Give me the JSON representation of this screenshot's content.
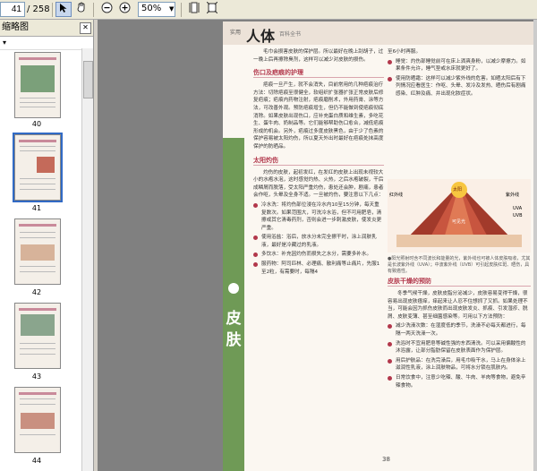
{
  "toolbar": {
    "page_current": "41",
    "page_total": "/ 258",
    "zoom": "50%",
    "icons": [
      "select-tool-icon",
      "hand-tool-icon",
      "zoom-out-icon",
      "zoom-in-icon",
      "fit-width-icon",
      "fit-page-icon"
    ]
  },
  "sidebar": {
    "title": "缩略图",
    "option_icon": "options-icon",
    "thumbs": [
      {
        "label": "40"
      },
      {
        "label": "41"
      },
      {
        "label": "42"
      },
      {
        "label": "43"
      },
      {
        "label": "44"
      }
    ]
  },
  "page": {
    "header_title": "人体",
    "header_sub": "实用",
    "header_tag": "百科全书",
    "side_label": "皮肤",
    "page_number": "38",
    "left": {
      "intro": "毛巾会损害皮肤的保护层。所以最好在晚上刮胡子，过一晚上后再擦除臭剂，这样可以减少对皮肤的损伤。",
      "h1": "伤口及疤痕的护理",
      "p1": "疤痕一旦产生，就不会消失，目前常用的几种疤痕治疗方法：切除疤痕至很健全，软组织扩张器扩张正常皮肤后修复疤痕；疤痕内药物注射，疤痕磨削术，外用药膏、涂等方法，可改善外观。预防疤痕增生，但仍不能做到使疤痕彻底消除。如果皮肤出现伤口，应补充蛋白质和维生素，多吃花生、蛋牛肉、奶制品等。它们能够帮助伤口愈合，减低疤痕形成的机会。另外，疤痕过多度皮肤黑色，由于少了色素的保护容易被太阳灼伤，所以夏天外出时最好在疤痕处抹高度保护的防晒品。",
      "h2": "太阳灼伤",
      "p2": "灼伤的皮肤，起初发红，在发红的皮肤上出现未视较大小的水疱水泡，这时感觉灼热、火热，之后水疱破裂，干后成鳞屑而脱落，受太阳严重灼伤，患处还会肿，剧痛，患者会作呕，头晕及全身不适。一旦被灼伤，要注意以下几点：",
      "b1": "冷水洗：将灼伤部位浸在冷水内10至15分钟，每天重复数次。如果范围大，可洗冷水浴，但不可用肥皂，清擦或其它清毒药剂，否则会进一步刺激皮肤，使发炎更严重。",
      "b2": "使用浴盐：浴后，放水分未完全擦干时，涂上润肤乳液，最好是冷藏过的乳液。",
      "b3": "多饮水：补充因灼伤而损失之水分，需要多补水。",
      "b4": "服药物：阿司匹林、必理痛、散利痛等止痛片，先服1至2粒，有需要时，每隔4"
    },
    "right": {
      "cont": "至6小时再服。",
      "b1": "睡觉：灼伤部睡觉前可在床上洒爽身粉，以减少摩擦力。如果条件允许，睡气垫或水床就更好了。",
      "b2": "使用防晒霜：这样可以减少紫外线的危害。如晒太阳后有下列情况应看医生：作呕、头晕、发冷及发热、晒伤后有剧痛感染、红肿及痛、并出现化脓症状。",
      "fig_labels": {
        "sun": "太阳",
        "ir": "红外线",
        "uv": "紫外线",
        "uva": "UVA",
        "uvb": "UVB",
        "visible": "可见光"
      },
      "caption": "●阳光照射时含不同波长和能量的光，紫外线也可被人体皮肤吸收，尤其是长波紫外线（UVA）；中波紫外线（UVB）可引起皮肤红斑、晒伤，具有致癌性。",
      "h3": "皮肤干燥的预防",
      "p3": "冬季气候干燥，皮肤皮脂分泌减少，皮肤容易变得干燥，很容易出现皮肤瘙痒，痒起来让人忍不住想抓了又抓。如果处理不当，可能会因为抓伤皮肤而出现皮肤发炎、抓痕、引发湿疹、脱屑、皮肤变薄、甚至细菌感染等。可用以下方法预防：",
      "b3": "减少洗澡次数：在湿度低的季节，洗澡不必每天都进行，每隔一两天洗澡一次。",
      "b4": "洗浴时不宜用肥皂等碱性强的东西清洗。可以采用偏酸性的沐浴露，让部分脂肪保留在皮肤表面作为保护层。",
      "b5": "用后护肤品：在洗完澡后，用毛巾吸干水，马上在身体涂上滋润性乳液，涂上润肤物品，可将水分锁在肌肤内。",
      "b6": "日常饮食中，注意少吃辣、酸、牛肉、羊肉等食物，避免辛辣食物。"
    }
  },
  "colors": {
    "accent": "#b2374b",
    "tab_green": "#6f9a56",
    "viewer_bg": "#808080"
  }
}
